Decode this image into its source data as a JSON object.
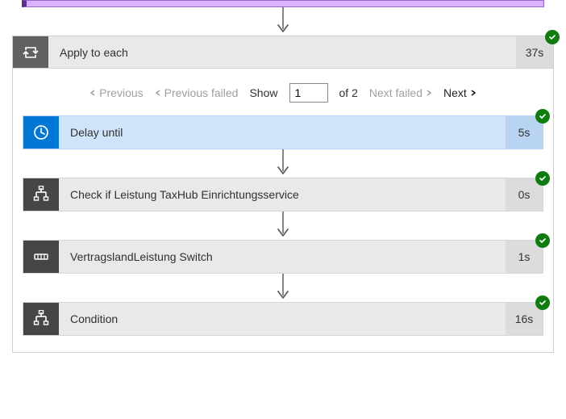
{
  "outer": {
    "title": "Apply to each",
    "time": "37s"
  },
  "pager": {
    "prev": "Previous",
    "prevFailed": "Previous failed",
    "show": "Show",
    "current": "1",
    "ofText": "of 2",
    "nextFailed": "Next failed",
    "next": "Next"
  },
  "steps": [
    {
      "title": "Delay until",
      "time": "5s",
      "iconColor": "blue",
      "iconType": "clock",
      "highlight": true
    },
    {
      "title": "Check if Leistung TaxHub Einrichtungsservice",
      "time": "0s",
      "iconColor": "dark",
      "iconType": "branch",
      "highlight": false
    },
    {
      "title": "VertragslandLeistung Switch",
      "time": "1s",
      "iconColor": "dark",
      "iconType": "switch",
      "highlight": false
    },
    {
      "title": "Condition",
      "time": "16s",
      "iconColor": "dark",
      "iconType": "branch",
      "highlight": false
    }
  ]
}
